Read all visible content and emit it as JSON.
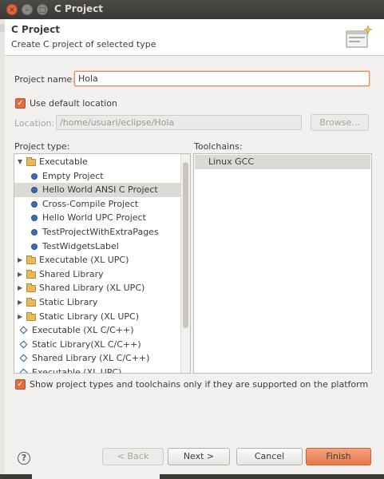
{
  "window": {
    "title": "C Project",
    "close_glyph": "×",
    "min_glyph": "–",
    "max_glyph": "□"
  },
  "header": {
    "title": "C Project",
    "subtitle": "Create C project of selected type",
    "icon": "wizard-banner-icon"
  },
  "project_name": {
    "label": "Project name:",
    "value": "Hola"
  },
  "default_location": {
    "label": "Use default location",
    "checked": true
  },
  "location": {
    "label": "Location:",
    "value": "/home/usuari/eclipse/Hola",
    "browse_label": "Browse..."
  },
  "project_type": {
    "label": "Project type:",
    "items": [
      {
        "label": "Executable",
        "kind": "folder",
        "level": 0,
        "expanded": true
      },
      {
        "label": "Empty Project",
        "kind": "dot",
        "level": 1
      },
      {
        "label": "Hello World ANSI C Project",
        "kind": "dot",
        "level": 1,
        "selected": true
      },
      {
        "label": "Cross-Compile Project",
        "kind": "dot",
        "level": 1
      },
      {
        "label": "Hello World UPC Project",
        "kind": "dot",
        "level": 1
      },
      {
        "label": "TestProjectWithExtraPages",
        "kind": "dot",
        "level": 1
      },
      {
        "label": "TestWidgetsLabel",
        "kind": "dot",
        "level": 1
      },
      {
        "label": "Executable (XL UPC)",
        "kind": "folder",
        "level": 0
      },
      {
        "label": "Shared Library",
        "kind": "folder",
        "level": 0
      },
      {
        "label": "Shared Library (XL UPC)",
        "kind": "folder",
        "level": 0
      },
      {
        "label": "Static Library",
        "kind": "folder",
        "level": 0
      },
      {
        "label": "Static Library (XL UPC)",
        "kind": "folder",
        "level": 0
      },
      {
        "label": "Executable (XL C/C++)",
        "kind": "diamond",
        "level": 0
      },
      {
        "label": "Static Library(XL C/C++)",
        "kind": "diamond",
        "level": 0
      },
      {
        "label": "Shared Library (XL C/C++)",
        "kind": "diamond",
        "level": 0
      },
      {
        "label": "Executable (XL UPC)",
        "kind": "diamond",
        "level": 0
      }
    ]
  },
  "toolchains": {
    "label": "Toolchains:",
    "items": [
      "Linux GCC"
    ]
  },
  "filter": {
    "label": "Show project types and toolchains only if they are supported on the platform",
    "checked": true
  },
  "buttons": {
    "help": "?",
    "back": "< Back",
    "next": "Next >",
    "cancel": "Cancel",
    "finish": "Finish"
  },
  "colors": {
    "accent": "#e8774a",
    "selection": "#dcdad5",
    "title_bar": "#3c3b37"
  }
}
